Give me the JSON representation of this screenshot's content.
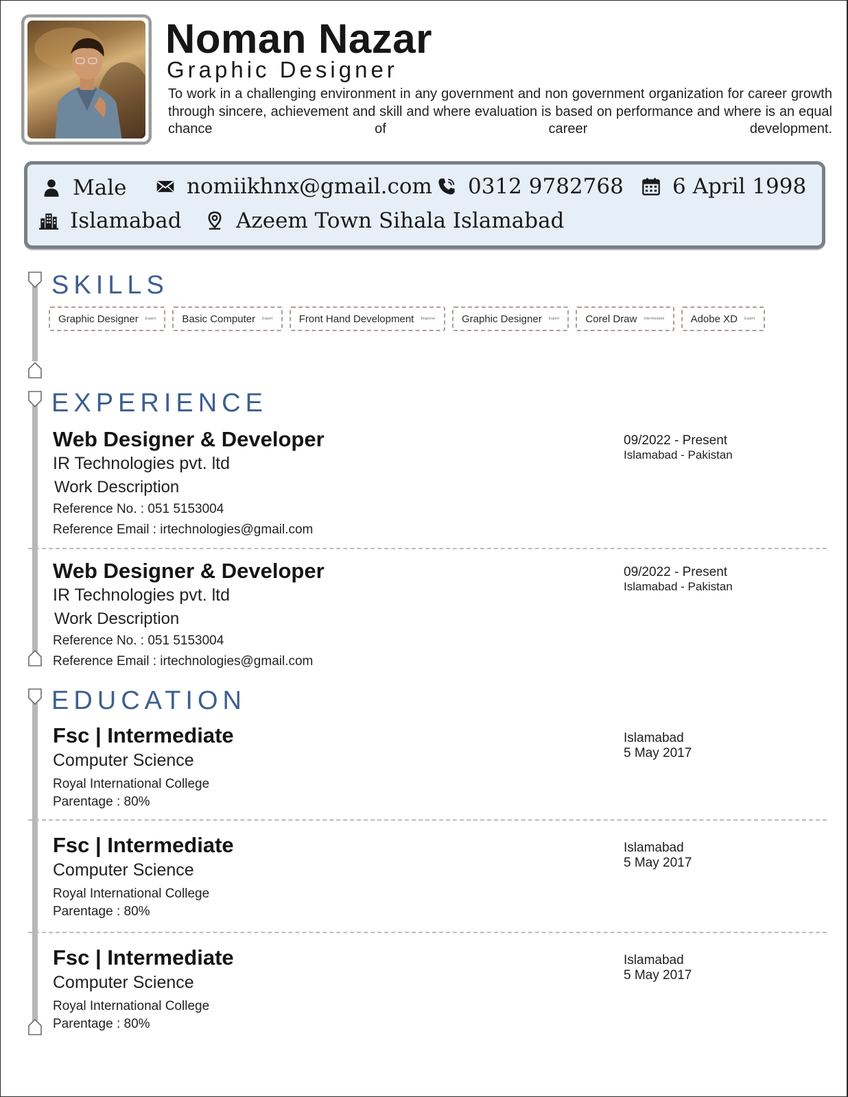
{
  "header": {
    "name": "Noman Nazar",
    "title": "Graphic Designer",
    "objective": "To work in a challenging environment in any government and non government organization for career growth through sincere, achievement and skill and where evaluation is based on performance and where is an equal chance of career development."
  },
  "contact": {
    "gender": "Male",
    "email": "nomiikhnx@gmail.com",
    "phone": "0312 9782768",
    "dob": "6 April 1998",
    "city": "Islamabad",
    "address": "Azeem Town Sihala Islamabad"
  },
  "sections": {
    "skills": "SKILLS",
    "experience": "EXPERIENCE",
    "education": "EDUCATION"
  },
  "skills": [
    {
      "name": "Graphic Designer",
      "level": "Expert"
    },
    {
      "name": "Basic Computer",
      "level": "Expert"
    },
    {
      "name": "Front Hand Development",
      "level": "Beginner"
    },
    {
      "name": "Graphic Designer",
      "level": "Expert"
    },
    {
      "name": "Corel Draw",
      "level": "Intermediate"
    },
    {
      "name": "Adobe XD",
      "level": "Expert"
    }
  ],
  "experience": [
    {
      "role": "Web Designer & Developer",
      "company": "IR Technologies pvt. ltd",
      "description": "Work Description",
      "reference_no": "Reference No. : 051 5153004",
      "reference_email": "Reference Email : irtechnologies@gmail.com",
      "period": "09/2022 - Present",
      "location": "Islamabad - Pakistan"
    },
    {
      "role": "Web Designer & Developer",
      "company": "IR Technologies pvt. ltd",
      "description": "Work Description",
      "reference_no": "Reference No. : 051 5153004",
      "reference_email": "Reference Email : irtechnologies@gmail.com",
      "period": "09/2022 - Present",
      "location": "Islamabad - Pakistan"
    }
  ],
  "education": [
    {
      "degree": "Fsc | Intermediate",
      "field": "Computer Science",
      "institute": "Royal International College",
      "percentage": "Parentage : 80%",
      "city": "Islamabad",
      "date": "5 May 2017"
    },
    {
      "degree": "Fsc | Intermediate",
      "field": "Computer Science",
      "institute": "Royal International College",
      "percentage": "Parentage : 80%",
      "city": "Islamabad",
      "date": "5 May 2017"
    },
    {
      "degree": "Fsc | Intermediate",
      "field": "Computer Science",
      "institute": "Royal International College",
      "percentage": "Parentage : 80%",
      "city": "Islamabad",
      "date": "5 May 2017"
    }
  ],
  "icons": {
    "gender": "user-icon",
    "email": "envelope-icon",
    "phone": "phone-icon",
    "dob": "calendar-icon",
    "city": "city-icon",
    "address": "map-pin-icon"
  },
  "colors": {
    "section_title": "#3d5f8f",
    "contact_bg": "#e6eef8",
    "rail": "#b7b7b7"
  }
}
